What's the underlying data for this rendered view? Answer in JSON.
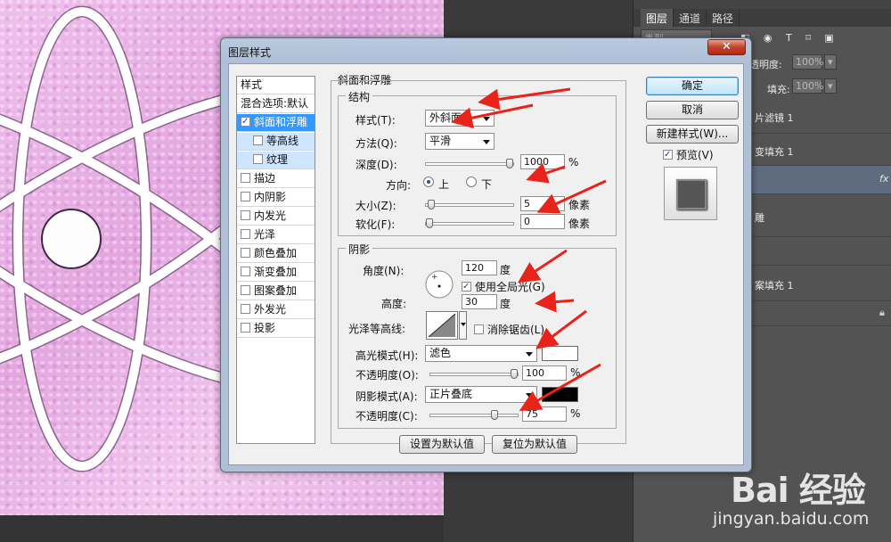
{
  "dialog": {
    "title": "图层样式",
    "close": "✕",
    "style_list_header": "样式",
    "style_items": [
      {
        "label": "混合选项:默认",
        "checkbox": false,
        "checked": false
      },
      {
        "label": "斜面和浮雕",
        "checkbox": true,
        "checked": true,
        "selected": true
      },
      {
        "label": "等高线",
        "checkbox": true,
        "checked": false,
        "sub": true
      },
      {
        "label": "纹理",
        "checkbox": true,
        "checked": false,
        "sub": true
      },
      {
        "label": "描边",
        "checkbox": true,
        "checked": false
      },
      {
        "label": "内阴影",
        "checkbox": true,
        "checked": false
      },
      {
        "label": "内发光",
        "checkbox": true,
        "checked": false
      },
      {
        "label": "光泽",
        "checkbox": true,
        "checked": false
      },
      {
        "label": "颜色叠加",
        "checkbox": true,
        "checked": false
      },
      {
        "label": "渐变叠加",
        "checkbox": true,
        "checked": false
      },
      {
        "label": "图案叠加",
        "checkbox": true,
        "checked": false
      },
      {
        "label": "外发光",
        "checkbox": true,
        "checked": false
      },
      {
        "label": "投影",
        "checkbox": true,
        "checked": false
      }
    ],
    "bevel": {
      "section_title": "斜面和浮雕",
      "structure_title": "结构",
      "style_label": "样式(T):",
      "style_value": "外斜面",
      "technique_label": "方法(Q):",
      "technique_value": "平滑",
      "depth_label": "深度(D):",
      "depth_value": "1000",
      "depth_level": 1.0,
      "percent": "%",
      "direction_label": "方向:",
      "direction_up": "上",
      "direction_down": "下",
      "size_label": "大小(Z):",
      "size_value": "5",
      "size_level": 0.02,
      "soften_label": "软化(F):",
      "soften_value": "0",
      "soften_level": 0.0,
      "px_unit": "像素"
    },
    "shading": {
      "title": "阴影",
      "angle_label": "角度(N):",
      "angle_value": "120",
      "degree": "度",
      "global_light": "使用全局光(G)",
      "global_light_checked": true,
      "altitude_label": "高度:",
      "altitude_value": "30",
      "gloss_label": "光泽等高线:",
      "antialias": "消除锯齿(L)",
      "highlight_mode_label": "高光模式(H):",
      "highlight_mode_value": "滤色",
      "highlight_color": "#ffffff",
      "highlight_opacity_label": "不透明度(O):",
      "highlight_opacity_value": "100",
      "highlight_opacity_level": 1.0,
      "shadow_mode_label": "阴影模式(A):",
      "shadow_mode_value": "正片叠底",
      "shadow_color": "#000000",
      "shadow_opacity_label": "不透明度(C):",
      "shadow_opacity_value": "75",
      "shadow_opacity_level": 0.75,
      "percent": "%"
    },
    "set_default": "设置为默认值",
    "reset_default": "复位为默认值",
    "ok": "确定",
    "cancel": "取消",
    "new_style": "新建样式(W)...",
    "preview": "预览(V)",
    "preview_checked": true
  },
  "layers_panel": {
    "tabs": [
      "图层",
      "通道",
      "路径"
    ],
    "kind_filter": "类型",
    "opacity_label": "透明度:",
    "opacity_value": "100%",
    "fill_label": "填充:",
    "fill_value": "100%",
    "layer_rows": [
      "片滤镜 1",
      "变填充 1",
      "fx",
      "雕",
      "案填充 1"
    ]
  },
  "watermark": {
    "brand": "Bai 经验",
    "url": "jingyan.baidu.com"
  },
  "colors": {
    "arrow_red": "#e8231a",
    "selected_blue": "#3399ff",
    "canvas_pink": "#eab3e6"
  }
}
